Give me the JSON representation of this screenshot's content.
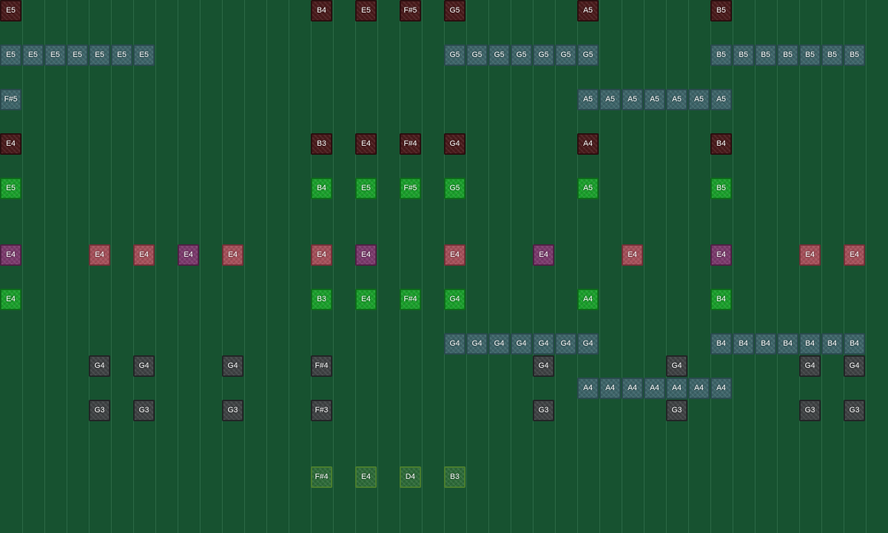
{
  "palette": {
    "background": "#175230",
    "gridline": "#2d6a47"
  },
  "styles": {
    "maroon": {
      "bg": "#4a1a1b",
      "border": "#2a0e0f"
    },
    "steel": {
      "bg": "#3d6469",
      "border": "#2a4a4e"
    },
    "lime": {
      "bg": "#1aa02b",
      "border": "#0d6a1a"
    },
    "purple": {
      "bg": "#7c3a6d",
      "border": "#4f2045"
    },
    "rose": {
      "bg": "#a6505a",
      "border": "#723037"
    },
    "slate": {
      "bg": "#3f4244",
      "border": "#222426"
    },
    "olive": {
      "bg": "#2d6b39",
      "border": "#4a7e2e"
    }
  },
  "piano_roll": {
    "columns": 40,
    "tracks": [
      {
        "name": "maroon-upper",
        "style": "maroon",
        "row": 0,
        "notes": [
          [
            0,
            "E5"
          ],
          [
            14,
            "B4"
          ],
          [
            16,
            "E5"
          ],
          [
            18,
            "F#5"
          ],
          [
            20,
            "G5"
          ],
          [
            26,
            "A5"
          ],
          [
            32,
            "B5"
          ]
        ]
      },
      {
        "name": "steel-e5",
        "style": "steel",
        "row": 2,
        "notes": [
          [
            0,
            "E5"
          ],
          [
            1,
            "E5"
          ],
          [
            2,
            "E5"
          ],
          [
            3,
            "E5"
          ],
          [
            4,
            "E5"
          ],
          [
            5,
            "E5"
          ],
          [
            6,
            "E5"
          ],
          [
            20,
            "G5"
          ],
          [
            21,
            "G5"
          ],
          [
            22,
            "G5"
          ],
          [
            23,
            "G5"
          ],
          [
            24,
            "G5"
          ],
          [
            25,
            "G5"
          ],
          [
            26,
            "G5"
          ],
          [
            32,
            "B5"
          ],
          [
            33,
            "B5"
          ],
          [
            34,
            "B5"
          ],
          [
            35,
            "B5"
          ],
          [
            36,
            "B5"
          ],
          [
            37,
            "B5"
          ],
          [
            38,
            "B5"
          ]
        ]
      },
      {
        "name": "steel-a5",
        "style": "steel",
        "row": 4,
        "notes": [
          [
            0,
            "F#5"
          ],
          [
            26,
            "A5"
          ],
          [
            27,
            "A5"
          ],
          [
            28,
            "A5"
          ],
          [
            29,
            "A5"
          ],
          [
            30,
            "A5"
          ],
          [
            31,
            "A5"
          ],
          [
            32,
            "A5"
          ]
        ]
      },
      {
        "name": "maroon-lower",
        "style": "maroon",
        "row": 6,
        "notes": [
          [
            0,
            "E4"
          ],
          [
            14,
            "B3"
          ],
          [
            16,
            "E4"
          ],
          [
            18,
            "F#4"
          ],
          [
            20,
            "G4"
          ],
          [
            26,
            "A4"
          ],
          [
            32,
            "B4"
          ]
        ]
      },
      {
        "name": "lime-upper",
        "style": "lime",
        "row": 8,
        "notes": [
          [
            0,
            "E5"
          ],
          [
            14,
            "B4"
          ],
          [
            16,
            "E5"
          ],
          [
            18,
            "F#5"
          ],
          [
            20,
            "G5"
          ],
          [
            26,
            "A5"
          ],
          [
            32,
            "B5"
          ]
        ]
      },
      {
        "name": "purple",
        "style": "purple",
        "row": 11,
        "notes": [
          [
            0,
            "E4"
          ],
          [
            8,
            "E4"
          ],
          [
            16,
            "E4"
          ],
          [
            24,
            "E4"
          ],
          [
            32,
            "E4"
          ]
        ]
      },
      {
        "name": "rose",
        "style": "rose",
        "row": 11,
        "notes": [
          [
            4,
            "E4"
          ],
          [
            6,
            "E4"
          ],
          [
            10,
            "E4"
          ],
          [
            14,
            "E4"
          ],
          [
            20,
            "E4"
          ],
          [
            28,
            "E4"
          ],
          [
            36,
            "E4"
          ],
          [
            38,
            "E4"
          ]
        ]
      },
      {
        "name": "lime-lower",
        "style": "lime",
        "row": 13,
        "notes": [
          [
            0,
            "E4"
          ],
          [
            14,
            "B3"
          ],
          [
            16,
            "E4"
          ],
          [
            18,
            "F#4"
          ],
          [
            20,
            "G4"
          ],
          [
            26,
            "A4"
          ],
          [
            32,
            "B4"
          ]
        ]
      },
      {
        "name": "steel-g4",
        "style": "steel",
        "row": 15,
        "notes": [
          [
            20,
            "G4"
          ],
          [
            21,
            "G4"
          ],
          [
            22,
            "G4"
          ],
          [
            23,
            "G4"
          ],
          [
            24,
            "G4"
          ],
          [
            25,
            "G4"
          ],
          [
            26,
            "G4"
          ],
          [
            32,
            "B4"
          ],
          [
            33,
            "B4"
          ],
          [
            34,
            "B4"
          ],
          [
            35,
            "B4"
          ],
          [
            36,
            "B4"
          ],
          [
            37,
            "B4"
          ],
          [
            38,
            "B4"
          ]
        ]
      },
      {
        "name": "slate-upper",
        "style": "slate",
        "row": 16,
        "notes": [
          [
            4,
            "G4"
          ],
          [
            6,
            "G4"
          ],
          [
            10,
            "G4"
          ],
          [
            14,
            "F#4"
          ],
          [
            24,
            "G4"
          ],
          [
            30,
            "G4"
          ],
          [
            36,
            "G4"
          ],
          [
            38,
            "G4"
          ]
        ]
      },
      {
        "name": "steel-a4",
        "style": "steel",
        "row": 17,
        "notes": [
          [
            26,
            "A4"
          ],
          [
            27,
            "A4"
          ],
          [
            28,
            "A4"
          ],
          [
            29,
            "A4"
          ],
          [
            30,
            "A4"
          ],
          [
            31,
            "A4"
          ],
          [
            32,
            "A4"
          ]
        ]
      },
      {
        "name": "slate-lower",
        "style": "slate",
        "row": 18,
        "notes": [
          [
            4,
            "G3"
          ],
          [
            6,
            "G3"
          ],
          [
            10,
            "G3"
          ],
          [
            14,
            "F#3"
          ],
          [
            24,
            "G3"
          ],
          [
            30,
            "G3"
          ],
          [
            36,
            "G3"
          ],
          [
            38,
            "G3"
          ]
        ]
      },
      {
        "name": "olive",
        "style": "olive",
        "row": 21,
        "notes": [
          [
            14,
            "F#4"
          ],
          [
            16,
            "E4"
          ],
          [
            18,
            "D4"
          ],
          [
            20,
            "B3"
          ]
        ]
      }
    ]
  }
}
